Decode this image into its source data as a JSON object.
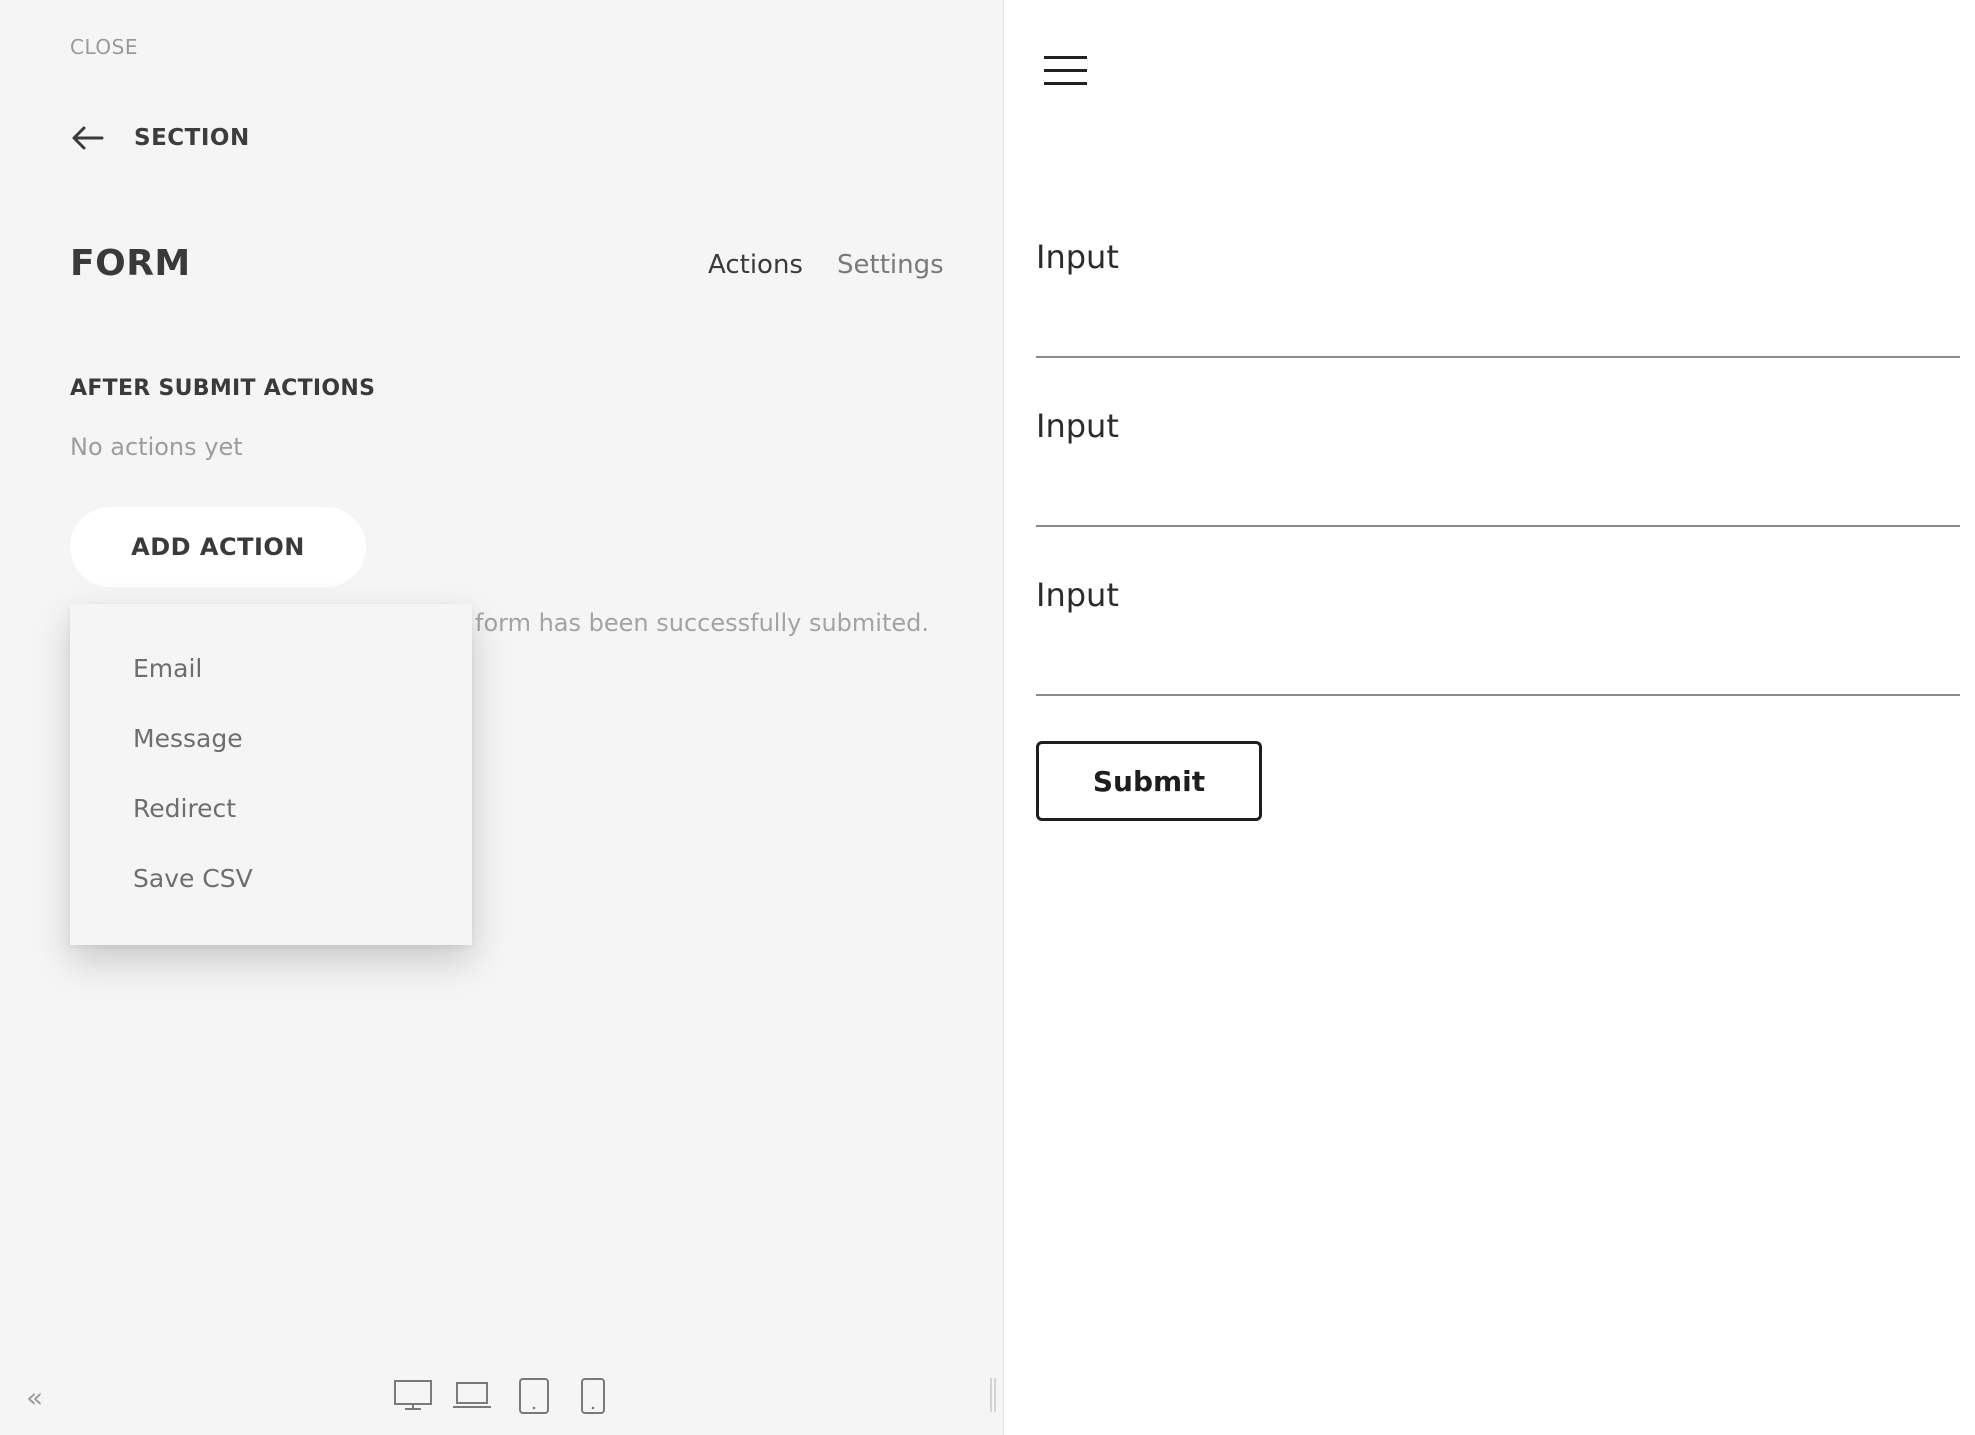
{
  "editor": {
    "close_label": "CLOSE",
    "back_label": "SECTION",
    "title": "FORM",
    "tabs": [
      {
        "label": "Actions"
      },
      {
        "label": "Settings"
      }
    ],
    "after_submit": {
      "heading": "AFTER SUBMIT ACTIONS",
      "empty_text": "No actions yet",
      "add_button": "ADD ACTION",
      "partial_message": "form has been successfully submited."
    },
    "dropdown": {
      "items": [
        {
          "label": "Email"
        },
        {
          "label": "Message"
        },
        {
          "label": "Redirect"
        },
        {
          "label": "Save CSV"
        }
      ]
    },
    "toolbar": {
      "collapse_label": "«",
      "devices": [
        "desktop-icon",
        "laptop-icon",
        "tablet-icon",
        "mobile-icon"
      ]
    }
  },
  "preview": {
    "menu_icon": "hamburger-menu-icon",
    "fields": [
      {
        "label": "Input",
        "value": ""
      },
      {
        "label": "Input",
        "value": ""
      },
      {
        "label": "Input",
        "value": ""
      }
    ],
    "submit_label": "Submit"
  },
  "colors": {
    "panel_bg": "#f5f5f5",
    "text_dark": "#3a3a3a",
    "text_muted": "#9d9d9d",
    "preview_bg": "#ffffff"
  }
}
